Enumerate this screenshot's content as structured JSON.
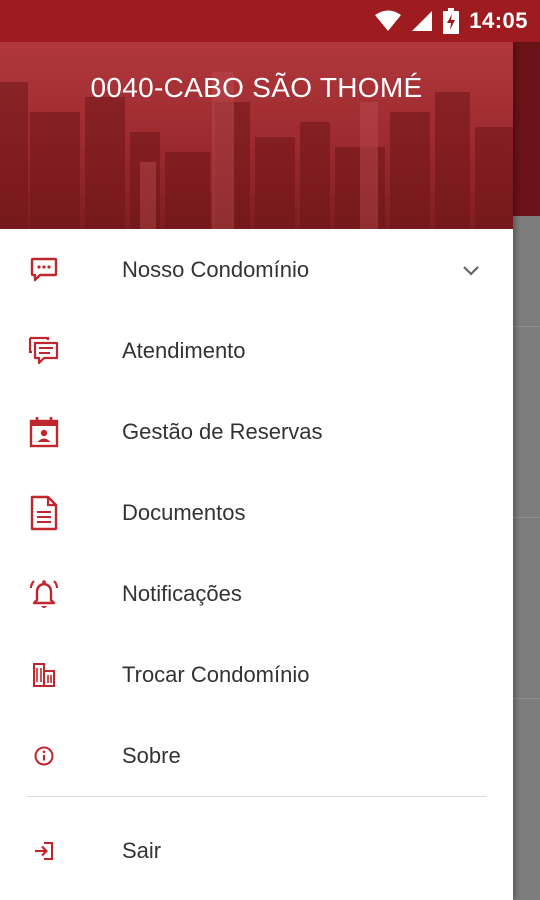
{
  "status_bar": {
    "time": "14:05",
    "icons": [
      "wifi-icon",
      "signal-icon",
      "battery-charging-icon"
    ]
  },
  "drawer": {
    "header_title": "0040-CABO SÃO THOMÉ",
    "items": [
      {
        "label": "Nosso Condomínio",
        "icon": "chat-bubble-icon",
        "expandable": true
      },
      {
        "label": "Atendimento",
        "icon": "conversation-icon"
      },
      {
        "label": "Gestão de Reservas",
        "icon": "calendar-person-icon"
      },
      {
        "label": "Documentos",
        "icon": "document-icon"
      },
      {
        "label": "Notificações",
        "icon": "bell-icon"
      },
      {
        "label": "Trocar Condomínio",
        "icon": "building-icon"
      },
      {
        "label": "Sobre",
        "icon": "info-icon"
      }
    ],
    "logout": {
      "label": "Sair",
      "icon": "logout-icon"
    }
  },
  "colors": {
    "primary": "#9e1b20",
    "icon": "#c0272d",
    "text": "#333333"
  }
}
